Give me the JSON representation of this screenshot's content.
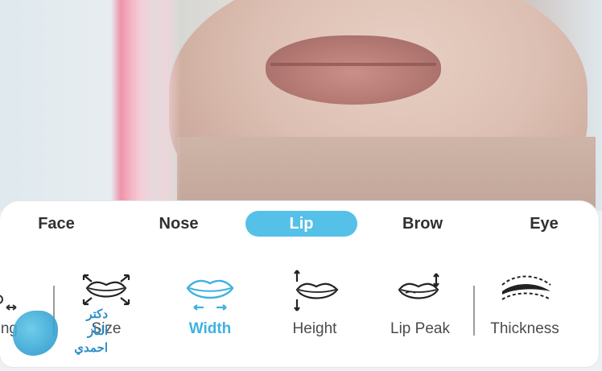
{
  "tabs": [
    {
      "label": "Face"
    },
    {
      "label": "Nose"
    },
    {
      "label": "Lip"
    },
    {
      "label": "Brow"
    },
    {
      "label": "Eye"
    }
  ],
  "active_tab": "Lip",
  "tools": {
    "partial_left": "ng",
    "items": [
      {
        "label": "Size",
        "icon": "lip-size-icon"
      },
      {
        "label": "Width",
        "icon": "lip-width-icon"
      },
      {
        "label": "Height",
        "icon": "lip-height-icon"
      },
      {
        "label": "Lip Peak",
        "icon": "lip-peak-icon"
      },
      {
        "label": "Thickness",
        "icon": "lip-thickness-icon"
      }
    ],
    "active_tool": "Width"
  },
  "watermark": {
    "lines": [
      "دكتر",
      "الناز",
      "احمدي"
    ]
  },
  "colors": {
    "accent": "#55c0e8",
    "active_label": "#3fb2e0",
    "text": "#2f3033"
  }
}
